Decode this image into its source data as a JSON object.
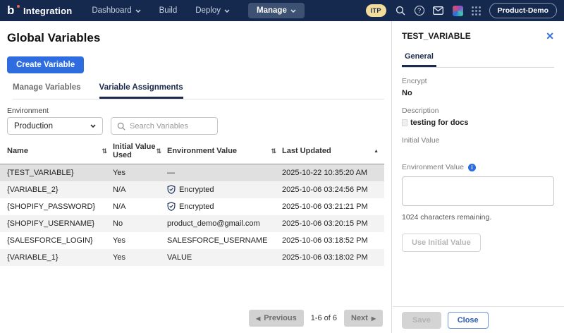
{
  "nav": {
    "brand": "Integration",
    "items": [
      {
        "label": "Dashboard"
      },
      {
        "label": "Build"
      },
      {
        "label": "Deploy"
      },
      {
        "label": "Manage"
      }
    ],
    "account_badge": "ITP",
    "tenant": "Product-Demo"
  },
  "page": {
    "title": "Global Variables",
    "create_button": "Create Variable",
    "tabs": [
      {
        "label": "Manage Variables"
      },
      {
        "label": "Variable Assignments"
      }
    ]
  },
  "filters": {
    "environment_label": "Environment",
    "environment_value": "Production",
    "search_placeholder": "Search Variables"
  },
  "table": {
    "columns": [
      "Name",
      "Initial Value Used",
      "Environment Value",
      "Last Updated"
    ],
    "rows": [
      {
        "name": "{TEST_VARIABLE}",
        "initial": "Yes",
        "env": "—",
        "encrypted": false,
        "updated": "2025-10-22 10:35:20 AM",
        "selected": true
      },
      {
        "name": "{VARIABLE_2}",
        "initial": "N/A",
        "env": "Encrypted",
        "encrypted": true,
        "updated": "2025-10-06 03:24:56 PM",
        "selected": false
      },
      {
        "name": "{SHOPIFY_PASSWORD}",
        "initial": "N/A",
        "env": "Encrypted",
        "encrypted": true,
        "updated": "2025-10-06 03:21:21 PM",
        "selected": false
      },
      {
        "name": "{SHOPIFY_USERNAME}",
        "initial": "No",
        "env": "product_demo@gmail.com",
        "encrypted": false,
        "updated": "2025-10-06 03:20:15 PM",
        "selected": false
      },
      {
        "name": "{SALESFORCE_LOGIN}",
        "initial": "Yes",
        "env": "SALESFORCE_USERNAME",
        "encrypted": false,
        "updated": "2025-10-06 03:18:52 PM",
        "selected": false
      },
      {
        "name": "{VARIABLE_1}",
        "initial": "Yes",
        "env": "VALUE",
        "encrypted": false,
        "updated": "2025-10-06 03:18:02 PM",
        "selected": false
      }
    ]
  },
  "pagination": {
    "previous": "Previous",
    "range": "1-6 of 6",
    "next": "Next"
  },
  "panel": {
    "title": "TEST_VARIABLE",
    "tab": "General",
    "encrypt_label": "Encrypt",
    "encrypt_value": "No",
    "description_label": "Description",
    "description_value": "testing for docs",
    "initial_label": "Initial Value",
    "env_label": "Environment Value",
    "chars_remaining": "1024 characters remaining.",
    "use_initial_button": "Use Initial Value",
    "save_button": "Save",
    "close_button": "Close"
  },
  "icons": {
    "sort": "⇅",
    "sort_asc": "▲",
    "close": "✕",
    "prev_arrow": "◀",
    "next_arrow": "▶",
    "help": "?",
    "info": "i"
  },
  "colors": {
    "nav_bg": "#15294e",
    "accent_blue": "#2e6ce0",
    "badge_yellow": "#f2dc9b",
    "selected_row": "#e0e0e0",
    "stripe_row": "#f3f3f3",
    "shield_navy": "#24395e"
  }
}
